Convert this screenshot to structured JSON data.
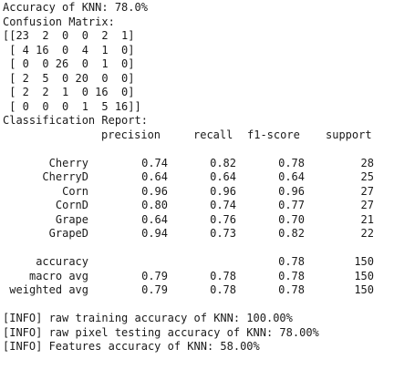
{
  "accuracy_line": "Accuracy of KNN: 78.0%",
  "confusion_matrix_title": "Confusion Matrix:",
  "confusion_matrix_rows": [
    "[[23  2  0  0  2  1]",
    " [ 4 16  0  4  1  0]",
    " [ 0  0 26  0  1  0]",
    " [ 2  5  0 20  0  0]",
    " [ 2  2  1  0 16  0]",
    " [ 0  0  0  1  5 16]]"
  ],
  "classification_report_title": "Classification Report:",
  "report_headers": {
    "precision": "precision",
    "recall": "recall",
    "f1": "f1-score",
    "support": "support"
  },
  "class_rows": [
    {
      "label": "Cherry",
      "precision": "0.74",
      "recall": "0.82",
      "f1": "0.78",
      "support": "28"
    },
    {
      "label": "CherryD",
      "precision": "0.64",
      "recall": "0.64",
      "f1": "0.64",
      "support": "25"
    },
    {
      "label": "Corn",
      "precision": "0.96",
      "recall": "0.96",
      "f1": "0.96",
      "support": "27"
    },
    {
      "label": "CornD",
      "precision": "0.80",
      "recall": "0.74",
      "f1": "0.77",
      "support": "27"
    },
    {
      "label": "Grape",
      "precision": "0.64",
      "recall": "0.76",
      "f1": "0.70",
      "support": "21"
    },
    {
      "label": "GrapeD",
      "precision": "0.94",
      "recall": "0.73",
      "f1": "0.82",
      "support": "22"
    }
  ],
  "summary_rows": [
    {
      "label": "accuracy",
      "precision": "",
      "recall": "",
      "f1": "0.78",
      "support": "150"
    },
    {
      "label": "macro avg",
      "precision": "0.79",
      "recall": "0.78",
      "f1": "0.78",
      "support": "150"
    },
    {
      "label": "weighted avg",
      "precision": "0.79",
      "recall": "0.78",
      "f1": "0.78",
      "support": "150"
    }
  ],
  "info_lines": [
    "[INFO] raw training accuracy of KNN: 100.00%",
    "[INFO] raw pixel testing accuracy of KNN: 78.00%",
    "[INFO] Features accuracy of KNN: 58.00%"
  ]
}
